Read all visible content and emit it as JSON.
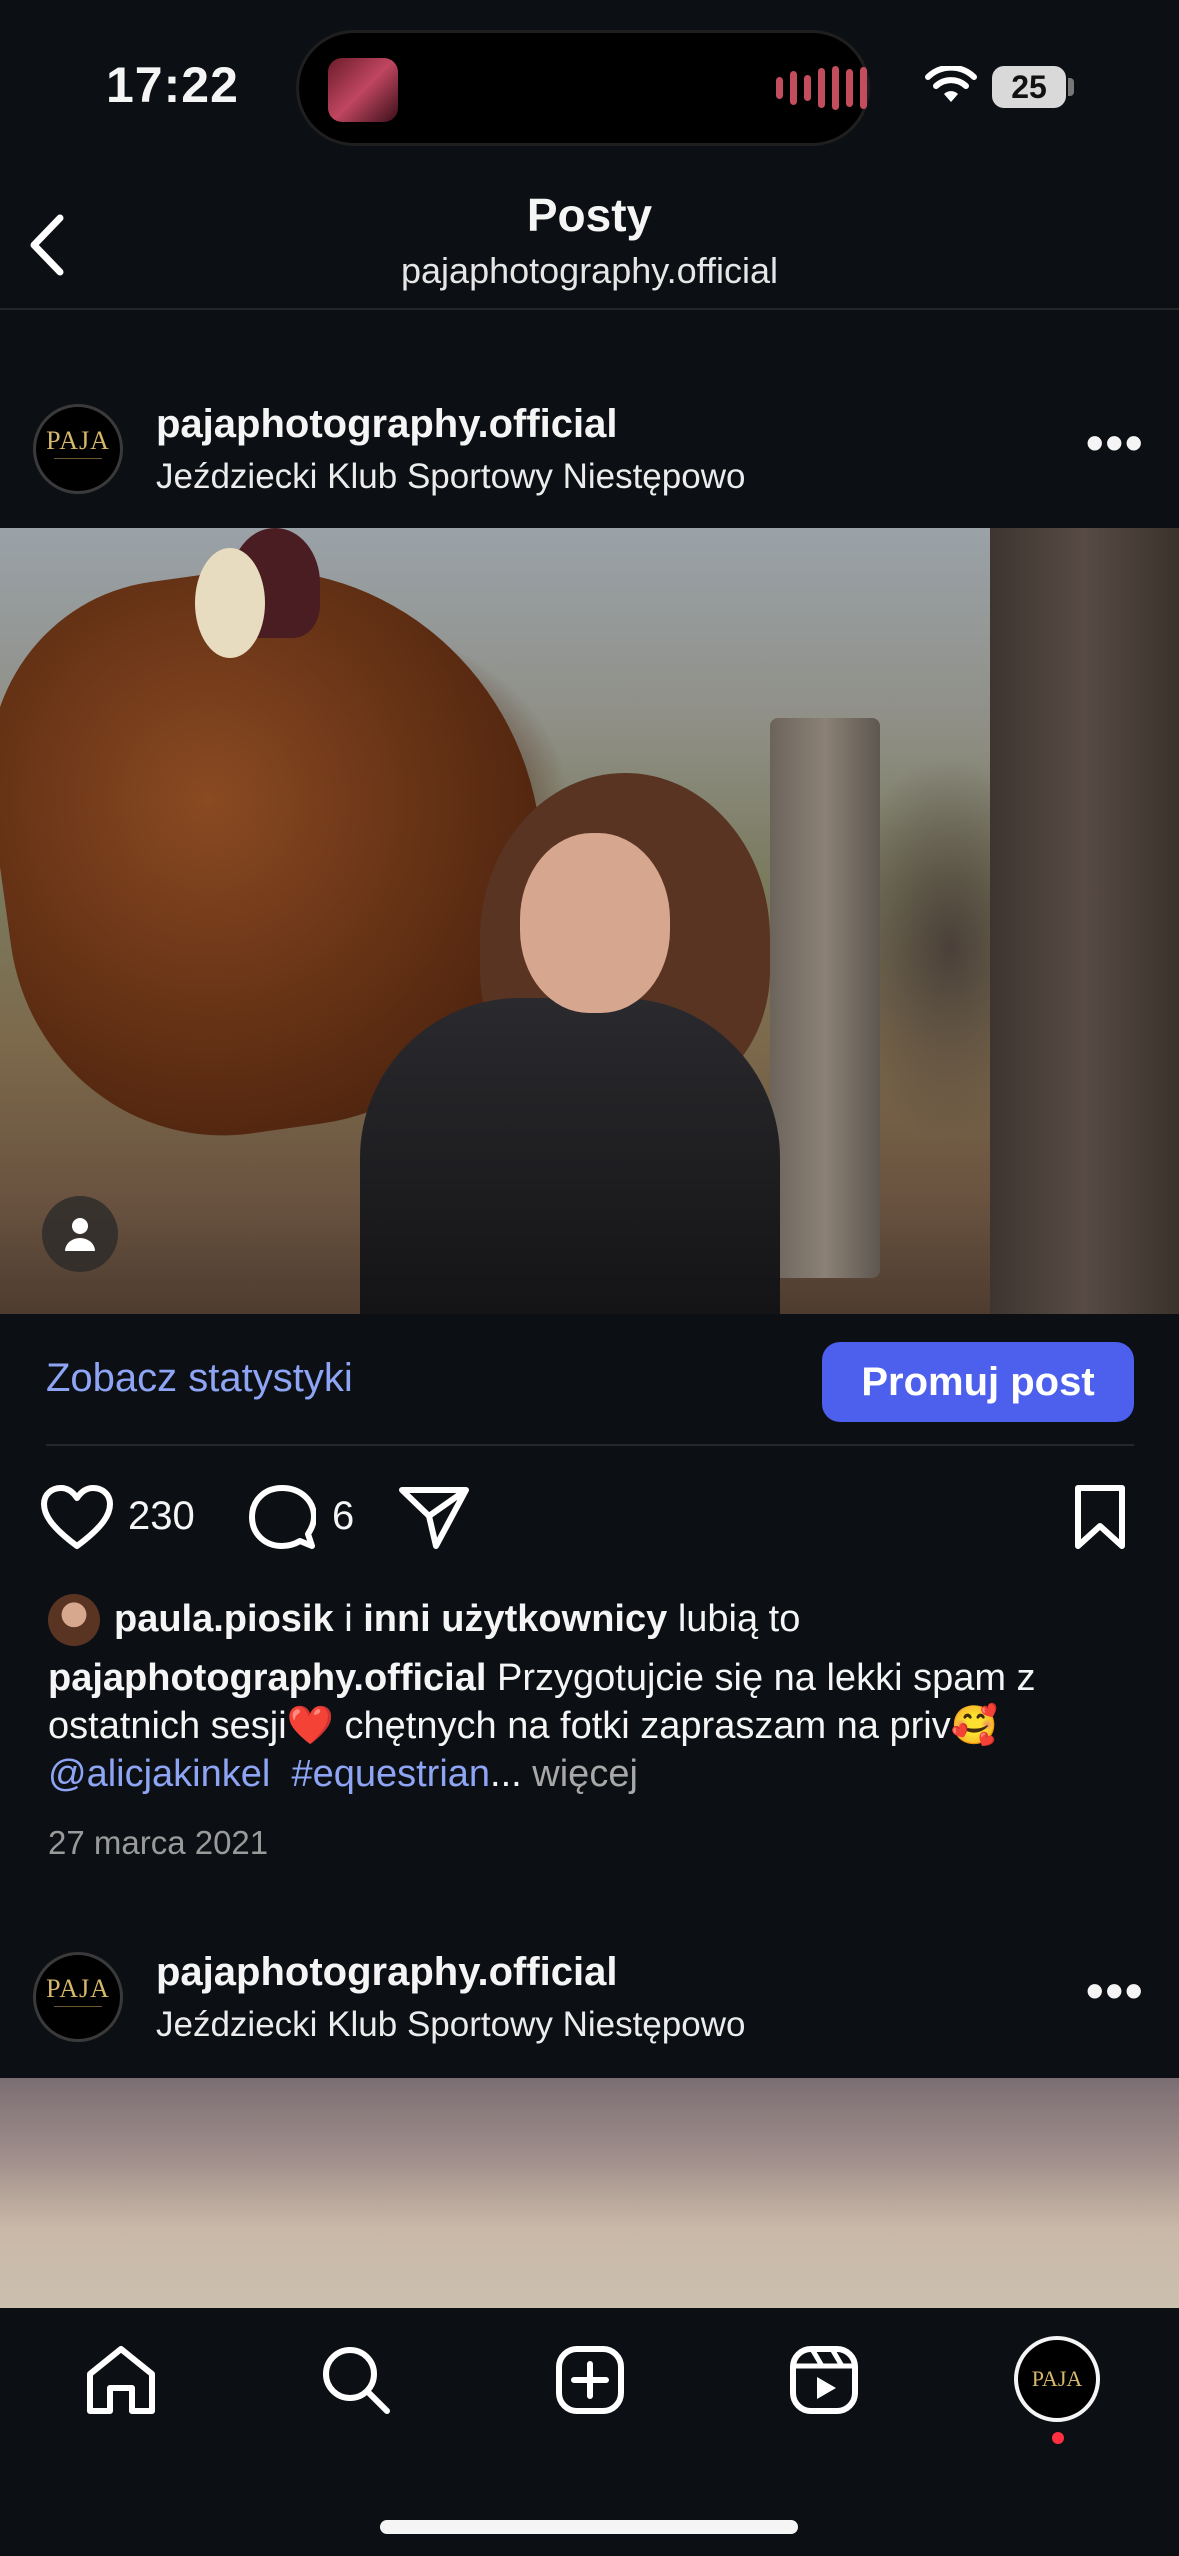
{
  "status_bar": {
    "time": "17:22",
    "battery": "25"
  },
  "header": {
    "title": "Posty",
    "subtitle": "pajaphotography.official"
  },
  "posts": [
    {
      "username": "pajaphotography.official",
      "location": "Jeździecki Klub Sportowy Niestępowo",
      "avatar_text": "PAJA",
      "stats_link": "Zobacz statystyki",
      "promote_label": "Promuj post",
      "likes_count": "230",
      "comments_count": "6",
      "liked_by_user": "paula.piosik",
      "liked_by_and": "i",
      "liked_by_others": "inni użytkownicy",
      "liked_by_suffix": "lubią to",
      "caption_user": "pajaphotography.official",
      "caption_text": "Przygotujcie się na lekki spam z ostatnich sesji❤️ chętnych na fotki zapraszam na priv🥰",
      "mention": "@alicjakinkel",
      "hashtag": "#equestrian",
      "ellipsis": "...",
      "more_label": "więcej",
      "date": "27 marca 2021"
    },
    {
      "username": "pajaphotography.official",
      "location": "Jeździecki Klub Sportowy Niestępowo",
      "avatar_text": "PAJA"
    }
  ],
  "tab_bar": {
    "items": [
      "home-icon",
      "search-icon",
      "create-icon",
      "reels-icon",
      "profile-avatar"
    ],
    "profile_avatar_text": "PAJA"
  },
  "colors": {
    "background": "#0c1014",
    "accent": "#4c5fed",
    "link": "#8ea4f5",
    "notification": "#ff3040"
  }
}
